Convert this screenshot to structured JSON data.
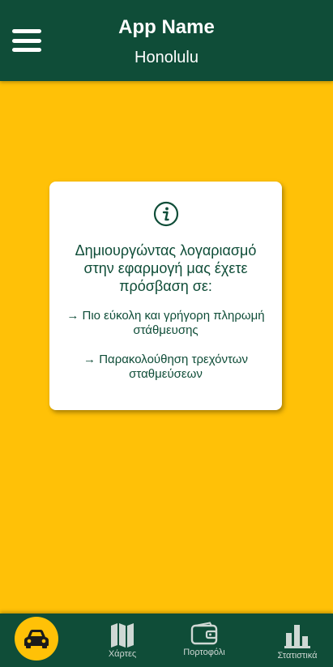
{
  "header": {
    "app_name": "App Name",
    "city": "Honolulu",
    "menu_icon": "hamburger-menu-icon"
  },
  "card": {
    "icon": "info-icon",
    "title": "Δημιουργώντας λογαριασμό στην εφαρμογή μας έχετε πρόσβαση σε:",
    "items": [
      "→ Πιο εύκολη και γρήγορη πληρωμή στάθμευσης",
      "→ Παρακολούθηση τρεχόντων σταθμεύσεων"
    ]
  },
  "bottom_nav": {
    "items": [
      {
        "icon": "car-icon",
        "label": ""
      },
      {
        "icon": "map-icon",
        "label": "Χάρτες"
      },
      {
        "icon": "wallet-icon",
        "label": "Πορτοφόλι"
      },
      {
        "icon": "bar-chart-icon",
        "label": "Στατιστικά"
      }
    ]
  },
  "colors": {
    "primary": "#0F4D38",
    "background": "#FFC107",
    "card": "#FFFFFF"
  }
}
